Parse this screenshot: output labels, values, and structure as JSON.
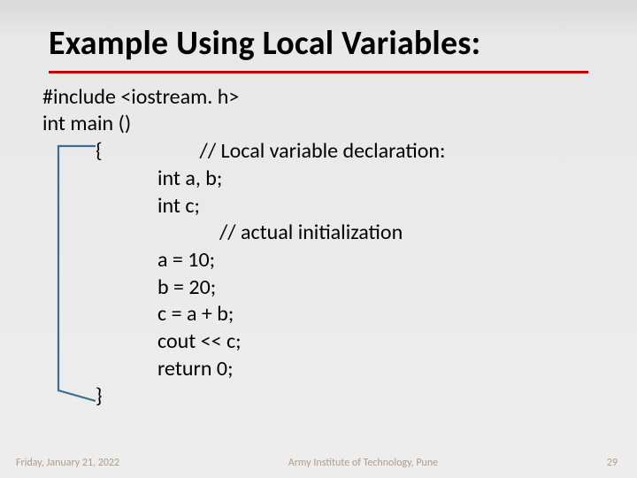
{
  "title": "Example Using Local Variables:",
  "code": {
    "l1": "#include <iostream. h>",
    "l2": "int main ()",
    "l3": "{",
    "c1": "// Local variable declaration:",
    "l4": "int a, b;",
    "l5": "int c;",
    "c2": "// actual initialization",
    "l6": "a = 10;",
    "l7": "b = 20;",
    "l8": "c = a + b;",
    "l9": "cout << c;",
    "l10": "return 0;",
    "l11": "}"
  },
  "footer": {
    "date": "Friday, January 21, 2022",
    "org": "Army Institute of Technology, Pune",
    "page": "29"
  },
  "colors": {
    "underline": "#c00000",
    "bracket": "#3b6e8f"
  }
}
